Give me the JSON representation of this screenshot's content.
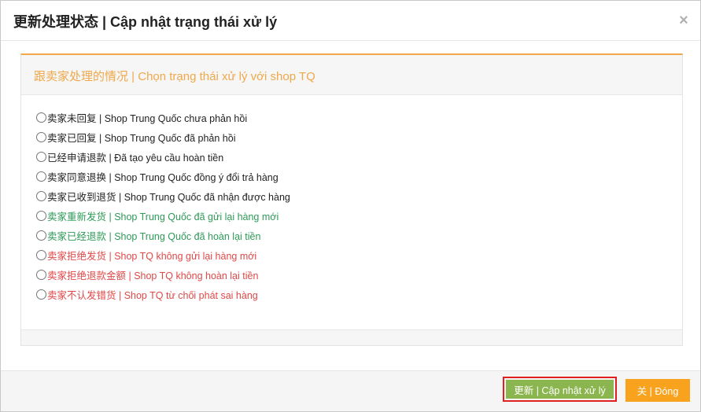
{
  "dialog": {
    "title": "更新处理状态 | Cập nhật trạng thái xử lý",
    "close_glyph": "×"
  },
  "panel": {
    "heading": "跟卖家处理的情况 | Chọn trạng thái xử lý với shop TQ",
    "options": [
      {
        "label": "卖家未回复 | Shop Trung Quốc chưa phản hồi",
        "tone": "default"
      },
      {
        "label": "卖家已回复 | Shop Trung Quốc đã phản hồi",
        "tone": "default"
      },
      {
        "label": "已经申请退款 | Đã tạo yêu cầu hoàn tiền",
        "tone": "default"
      },
      {
        "label": "卖家同意退换 | Shop Trung Quốc đồng ý đổi trả hàng",
        "tone": "default"
      },
      {
        "label": "卖家已收到退货 | Shop Trung Quốc đã nhận được hàng",
        "tone": "default"
      },
      {
        "label": "卖家重新发货 | Shop Trung Quốc đã gửi lại hàng mới",
        "tone": "green"
      },
      {
        "label": "卖家已经退款 | Shop Trung Quốc đã hoàn lại tiền",
        "tone": "green"
      },
      {
        "label": "卖家拒绝发货 | Shop TQ không gửi lại hàng mới",
        "tone": "red"
      },
      {
        "label": "卖家拒绝退款金额 | Shop TQ không hoàn lại tiền",
        "tone": "red"
      },
      {
        "label": "卖家不认发错货 | Shop TQ từ chối phát sai hàng",
        "tone": "red"
      }
    ]
  },
  "footer": {
    "update_label": "更新 | Cập nhật xử lý",
    "close_label": "关 | Đóng"
  },
  "colors": {
    "accent_orange": "#f0a84a",
    "green_text": "#2e9a57",
    "red_text": "#e04848",
    "update_button": "#8bb54f",
    "close_button": "#f8a21e",
    "highlight_border": "#e02020"
  }
}
